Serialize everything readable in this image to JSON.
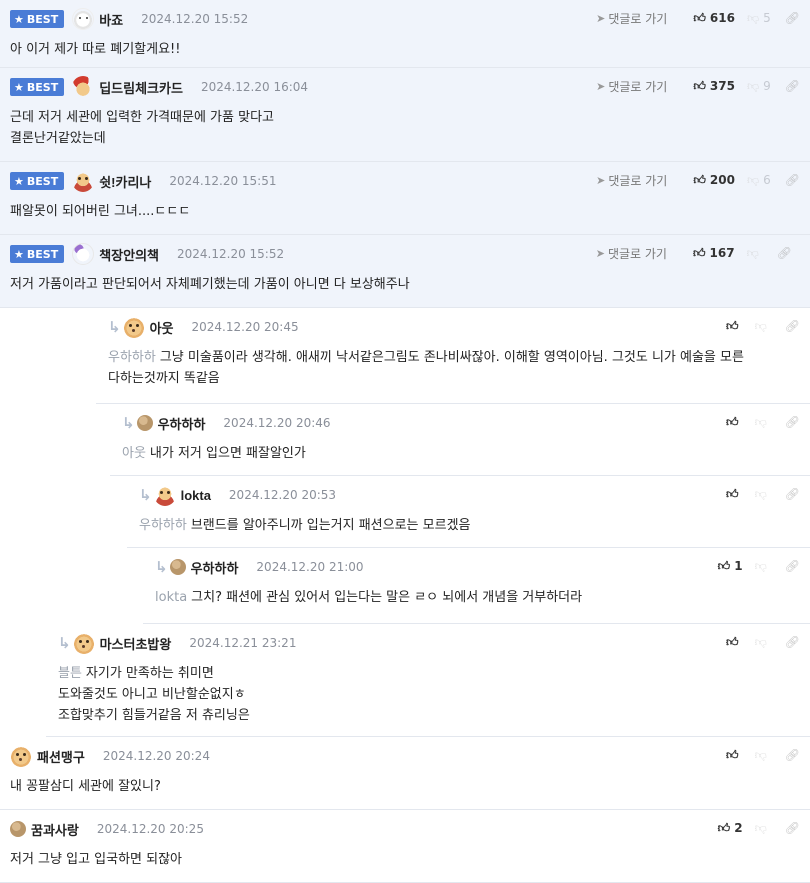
{
  "best_label": "BEST",
  "goto_label": "댓글로 가기",
  "comments": [
    {
      "nick": "바죠",
      "date": "2024.12.20 15:52",
      "likes": "616",
      "dislikes": "5",
      "lines": [
        "아 이거 제가 따로 폐기할게요!!"
      ],
      "best": true,
      "avatar": "white-dog-icon"
    },
    {
      "nick": "딥드림체크카드",
      "date": "2024.12.20 16:04",
      "likes": "375",
      "dislikes": "9",
      "lines": [
        "근데 저거 세관에 입력한 가격때문에 가품 맞다고",
        "결론난거같았는데"
      ],
      "best": true,
      "avatar": "santa-dog-icon"
    },
    {
      "nick": "쉿!카리나",
      "date": "2024.12.20 15:51",
      "likes": "200",
      "dislikes": "6",
      "lines": [
        "패알못이 되어버린 그녀....ㄷㄷㄷ"
      ],
      "best": true,
      "avatar": "red-dog-icon"
    },
    {
      "nick": "책장안의책",
      "date": "2024.12.20 15:52",
      "likes": "167",
      "dislikes": "",
      "lines": [
        "저거 가품이라고 판단되어서 자체폐기했는데 가품이 아니면 다 보상해주나"
      ],
      "best": true,
      "avatar": "bear-icon"
    },
    {
      "nick": "아웃",
      "date": "2024.12.20 20:45",
      "likes": "",
      "mention": "우하하하",
      "lines": [
        "그냥 미술품이라 생각해. 애새끼 낙서같은그림도 존나비싸잖아. 이해할 영역이아님. 그것도 니가 예술을 모른",
        "다하는것까지 똑같음"
      ],
      "avatar": "dog-icon"
    },
    {
      "nick": "우하하하",
      "date": "2024.12.20 20:46",
      "likes": "",
      "mention": "아웃",
      "lines": [
        "내가 저거 입으면 패잘알인가"
      ],
      "avatar": "plain-avatar-icon"
    },
    {
      "nick": "lokta",
      "date": "2024.12.20 20:53",
      "likes": "",
      "mention": "우하하하",
      "lines": [
        "브랜드를 알아주니까 입는거지 패션으로는 모르겠음"
      ],
      "avatar": "red-dog-icon"
    },
    {
      "nick": "우하하하",
      "date": "2024.12.20 21:00",
      "likes": "1",
      "mention": "lokta",
      "lines": [
        "그치? 패션에 관심 있어서 입는다는 말은 ㄹㅇ 뇌에서 개념을 거부하더라"
      ],
      "avatar": "plain-avatar-icon"
    },
    {
      "nick": "마스터초밥왕",
      "date": "2024.12.21 23:21",
      "likes": "",
      "mention": "블튼",
      "lines": [
        "자기가 만족하는 취미면",
        "도와줄것도 아니고 비난할순없지ㅎ",
        "조합맞추기 힘들거같음 저 츄리닝은"
      ],
      "avatar": "dog-icon"
    },
    {
      "nick": "패션맹구",
      "date": "2024.12.20 20:24",
      "likes": "",
      "lines": [
        "내 꽁팔삼디 세관에 잘있니?"
      ],
      "avatar": "dog-icon"
    },
    {
      "nick": "꿈과사랑",
      "date": "2024.12.20 20:25",
      "likes": "2",
      "lines": [
        "저거 그냥 입고 입국하면 되잖아"
      ],
      "avatar": "plain-avatar-icon"
    }
  ]
}
